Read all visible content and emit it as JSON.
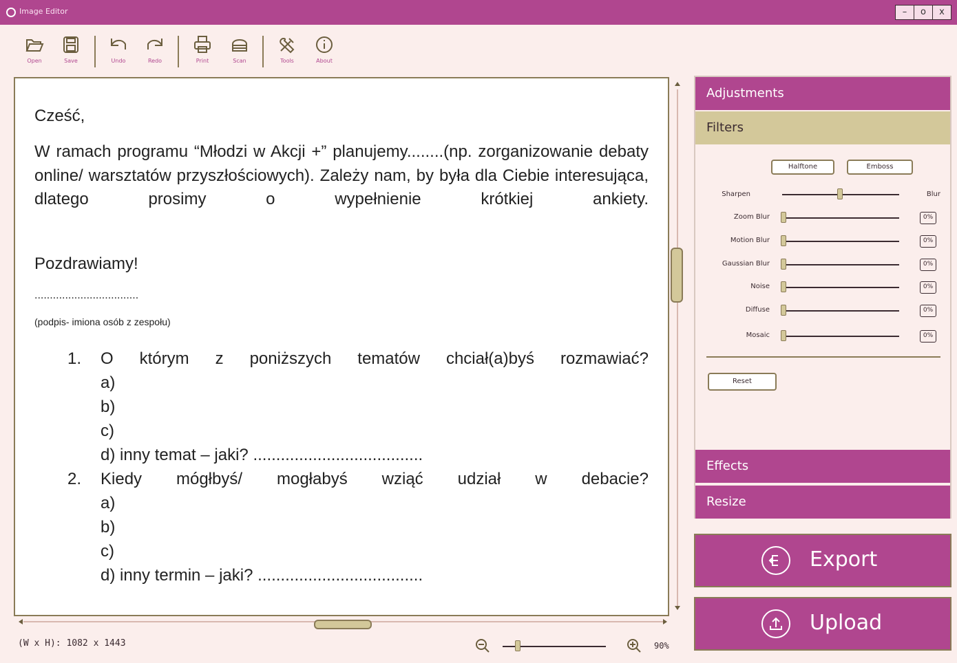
{
  "window": {
    "title": "Image Editor",
    "controls": [
      "–",
      "o",
      "x"
    ]
  },
  "toolbar": {
    "items": [
      {
        "label": "Open",
        "icon": "folder-open-icon"
      },
      {
        "label": "Save",
        "icon": "save-icon"
      },
      {
        "label": "Undo",
        "icon": "undo-icon"
      },
      {
        "label": "Redo",
        "icon": "redo-icon"
      },
      {
        "label": "Print",
        "icon": "printer-icon"
      },
      {
        "label": "Scan",
        "icon": "scanner-icon"
      },
      {
        "label": "Tools",
        "icon": "tools-icon"
      },
      {
        "label": "About",
        "icon": "info-icon"
      }
    ]
  },
  "document": {
    "greeting": "Cześć,",
    "paragraph": "W ramach programu “Młodzi w Akcji +” planujemy........(np. zorganizowanie debaty online/ warsztatów przyszłościowych). Zależy nam, by była dla Ciebie interesująca, dlatego prosimy o wypełnienie krótkiej ankiety.",
    "closing": "Pozdrawiamy!",
    "signature_dots": "..................................",
    "signature_note": "(podpis- imiona osób z zespołu)",
    "q1_num": "1.",
    "q1_text": "O którym z poniższych tematów chciał(a)byś rozmawiać?",
    "q1_a": "a)",
    "q1_b": "b)",
    "q1_c": "c)",
    "q1_d": "d) inny temat – jaki? .....................................",
    "q2_num": "2.",
    "q2_text": "Kiedy mógłbyś/ mogłabyś wziąć udział w debacie?",
    "q2_a": "a)",
    "q2_b": "b)",
    "q2_c": "c)",
    "q2_d": "d) inny termin – jaki? ...................................."
  },
  "status": {
    "dimensions": "(W x H): 1082 x 1443",
    "zoom": "90%"
  },
  "panel": {
    "adjustments": "Adjustments",
    "filters": "Filters",
    "halftone": "Halftone",
    "emboss": "Emboss",
    "sharpen": "Sharpen",
    "blur": "Blur",
    "sliders": [
      {
        "label": "Zoom Blur",
        "value": "0%"
      },
      {
        "label": "Motion Blur",
        "value": "0%"
      },
      {
        "label": "Gaussian Blur",
        "value": "0%"
      },
      {
        "label": "Noise",
        "value": "0%"
      },
      {
        "label": "Diffuse",
        "value": "0%"
      },
      {
        "label": "Mosaic",
        "value": "0%"
      }
    ],
    "reset": "Reset",
    "effects": "Effects",
    "resize": "Resize"
  },
  "actions": {
    "export": "Export",
    "upload": "Upload"
  }
}
